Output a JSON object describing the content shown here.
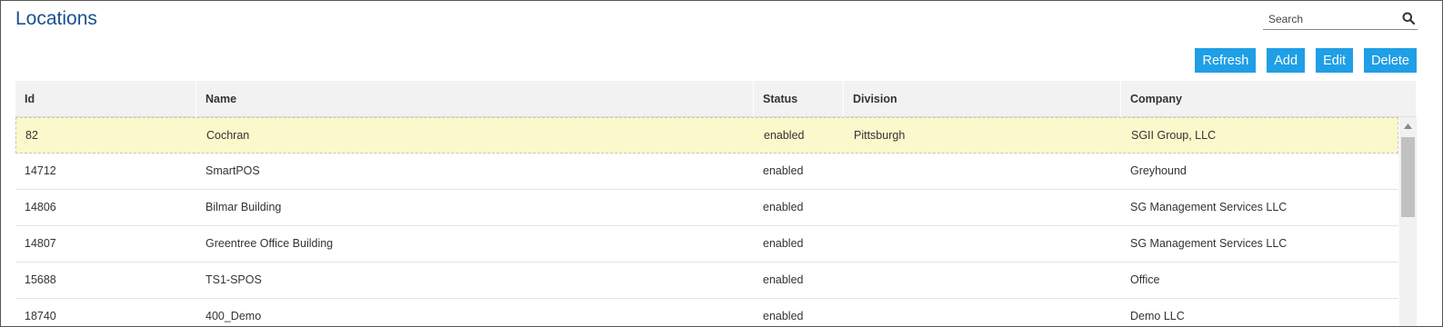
{
  "page": {
    "title": "Locations"
  },
  "search": {
    "placeholder": "Search",
    "icon": "search-icon"
  },
  "toolbar": {
    "refresh_label": "Refresh",
    "add_label": "Add",
    "edit_label": "Edit",
    "delete_label": "Delete",
    "button_color": "#1e9fe6"
  },
  "table": {
    "columns": [
      "Id",
      "Name",
      "Status",
      "Division",
      "Company"
    ],
    "rows": [
      {
        "id": "82",
        "name": "Cochran",
        "status": "enabled",
        "division": "Pittsburgh",
        "company": "SGII Group, LLC",
        "selected": true
      },
      {
        "id": "14712",
        "name": "SmartPOS",
        "status": "enabled",
        "division": "",
        "company": "Greyhound"
      },
      {
        "id": "14806",
        "name": "Bilmar Building",
        "status": "enabled",
        "division": "",
        "company": "SG Management Services LLC"
      },
      {
        "id": "14807",
        "name": "Greentree Office Building",
        "status": "enabled",
        "division": "",
        "company": "SG Management Services LLC"
      },
      {
        "id": "15688",
        "name": "TS1-SPOS",
        "status": "enabled",
        "division": "",
        "company": "Office"
      },
      {
        "id": "18740",
        "name": "400_Demo",
        "status": "enabled",
        "division": "",
        "company": "Demo LLC"
      }
    ],
    "selected_row_color": "#fbf8cc"
  }
}
